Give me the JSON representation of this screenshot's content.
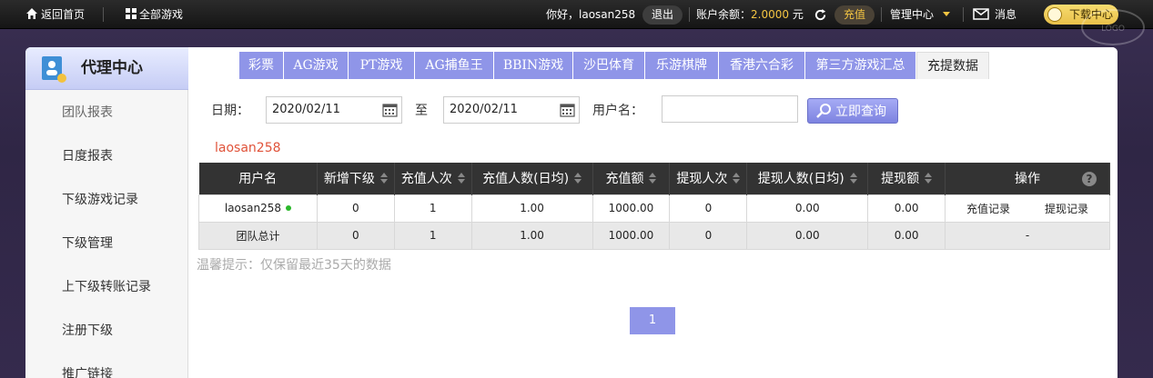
{
  "topbar": {
    "home_label": "返回首页",
    "all_games_label": "全部游戏",
    "greeting": "你好，laosan258",
    "logout_label": "退出",
    "balance_label": "账户余额：",
    "balance_value": "2.0000",
    "balance_unit": "元",
    "recharge_label": "充值",
    "manage_label": "管理中心",
    "message_label": "消息",
    "download_label": "下载中心"
  },
  "sidebar": {
    "title": "代理中心",
    "items": [
      {
        "label": "团队报表",
        "active": true
      },
      {
        "label": "日度报表"
      },
      {
        "label": "下级游戏记录"
      },
      {
        "label": "下级管理"
      },
      {
        "label": "上下级转账记录"
      },
      {
        "label": "注册下级"
      },
      {
        "label": "推广链接"
      }
    ]
  },
  "tabs": [
    {
      "label": "彩票"
    },
    {
      "label": "AG游戏"
    },
    {
      "label": "PT游戏"
    },
    {
      "label": "AG捕鱼王"
    },
    {
      "label": "BBIN游戏"
    },
    {
      "label": "沙巴体育"
    },
    {
      "label": "乐游棋牌"
    },
    {
      "label": "香港六合彩"
    },
    {
      "label": "第三方游戏汇总"
    },
    {
      "label": "充提数据",
      "active": true
    }
  ],
  "filter": {
    "date_label": "日期：",
    "date_from": "2020/02/11",
    "to_label": "至",
    "date_to": "2020/02/11",
    "username_label": "用户名：",
    "username_value": "",
    "query_label": "立即查询"
  },
  "current_user": "laosan258",
  "table": {
    "columns": [
      "用户名",
      "新增下级",
      "充值人次",
      "充值人数(日均)",
      "充值额",
      "提现人次",
      "提现人数(日均)",
      "提现额",
      "操作"
    ],
    "rows": [
      {
        "username": "laosan258",
        "new_sub": "0",
        "recharge_times": "1",
        "recharge_users": "1.00",
        "recharge_amount": "1000.00",
        "withdraw_times": "0",
        "withdraw_users": "0.00",
        "withdraw_amount": "0.00",
        "op1": "充值记录",
        "op2": "提现记录"
      }
    ],
    "total": {
      "label": "团队总计",
      "new_sub": "0",
      "recharge_times": "1",
      "recharge_users": "1.00",
      "recharge_amount": "1000.00",
      "withdraw_times": "0",
      "withdraw_users": "0.00",
      "withdraw_amount": "0.00",
      "op": "-"
    }
  },
  "hint": "温馨提示：仅保留最近35天的数据",
  "pagination": {
    "current_page": "1"
  },
  "colors": {
    "accent": "#8f95e8",
    "gold": "#f4c542",
    "user_highlight": "#e0533a"
  }
}
